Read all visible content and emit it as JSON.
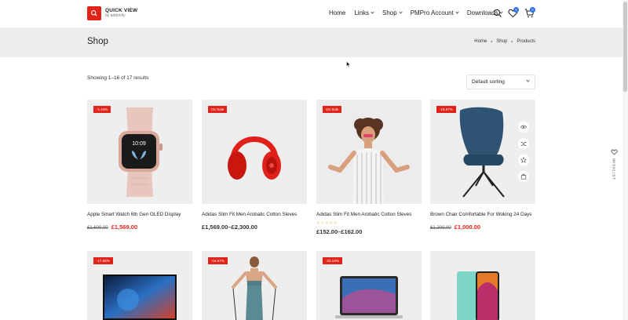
{
  "logo": {
    "title": "QUICK VIEW",
    "subtitle": "by addonify"
  },
  "nav": {
    "items": [
      {
        "label": "Home",
        "dropdown": false
      },
      {
        "label": "Links",
        "dropdown": true
      },
      {
        "label": "Shop",
        "dropdown": true
      },
      {
        "label": "PMPro Account",
        "dropdown": true
      },
      {
        "label": "Downloads",
        "dropdown": true
      }
    ],
    "wishlist_count": "0",
    "cart_count": "0"
  },
  "titlebar": {
    "title": "Shop",
    "breadcrumbs": [
      "Home",
      "Shop",
      "Products"
    ]
  },
  "toolbar": {
    "results": "Showing 1–16 of 17 results",
    "sort_selected": "Default sorting"
  },
  "products": [
    {
      "badge": "-1.44%",
      "name": "Apple Smart Watch 6th Gen OLED Display",
      "old_price": "£1,600.00",
      "price": "£1,569.00",
      "image": "smartwatch"
    },
    {
      "badge": "On Sale",
      "name": "Adidas Slim Fit Men Arobatic Cotton Sleves",
      "price_range": "£1,569.00–£2,300.00",
      "image": "headphones"
    },
    {
      "badge": "On Sale",
      "name": "Adidas Slim Fit Men Arobatic Cotton Sleves",
      "rating_stars": "☆☆☆☆☆",
      "price_range": "£152.00–£162.00",
      "image": "woman-shrugging"
    },
    {
      "badge": "-16.67%",
      "name": "Brown Chair Comfortable For Woking 24 Days",
      "old_price": "£1,200.00",
      "price": "£1,000.00",
      "image": "chair"
    }
  ],
  "products_row2": [
    {
      "badge": "-17.65%",
      "image": "monitor"
    },
    {
      "badge": "-16.67%",
      "image": "fitness-woman"
    },
    {
      "badge": "-22.14%",
      "image": "laptop"
    },
    {
      "badge": "",
      "image": "smartphone"
    }
  ],
  "wishlist_tab": {
    "label": "WISHLIST"
  },
  "colors": {
    "accent": "#e2231a",
    "badge_blue": "#2b6de0",
    "titlebar_bg": "#ededed",
    "card_bg": "#eeeeee"
  }
}
